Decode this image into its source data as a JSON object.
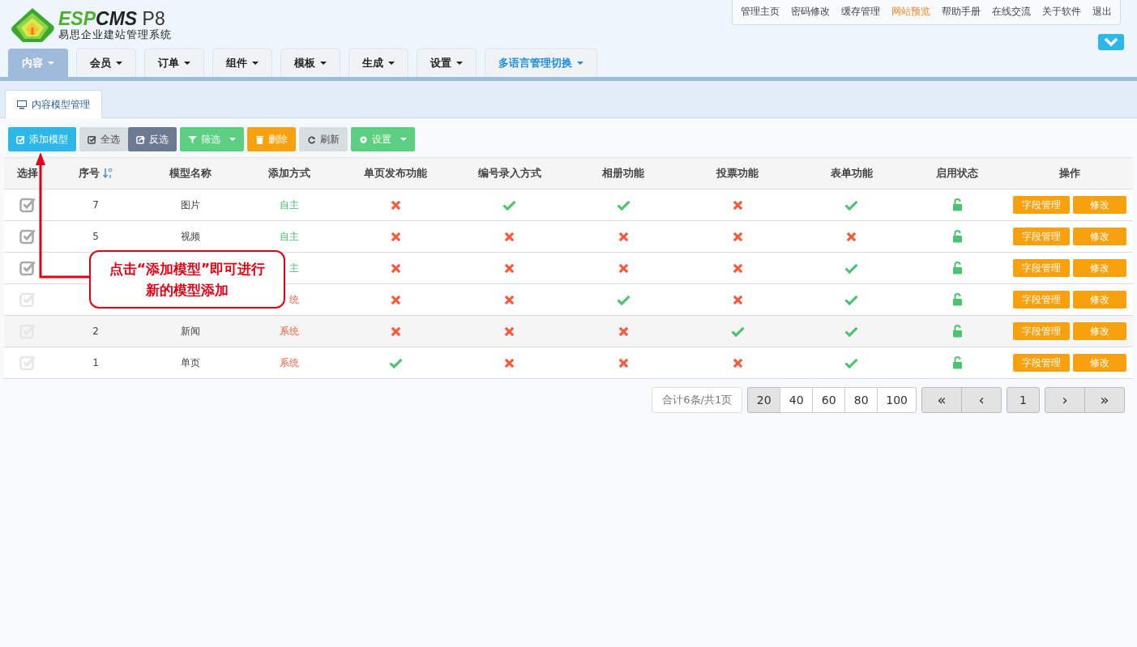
{
  "logo": {
    "brand_a": "ESP",
    "brand_b": "CMS",
    "version": "P8",
    "subtitle": "易思企业建站管理系统"
  },
  "top_links": [
    {
      "label": "管理主页",
      "highlighted": false
    },
    {
      "label": "密码修改",
      "highlighted": false
    },
    {
      "label": "缓存管理",
      "highlighted": false
    },
    {
      "label": "网站预览",
      "highlighted": true
    },
    {
      "label": "帮助手册",
      "highlighted": false
    },
    {
      "label": "在线交流",
      "highlighted": false
    },
    {
      "label": "关于软件",
      "highlighted": false
    },
    {
      "label": "退出",
      "highlighted": false
    }
  ],
  "nav_tabs": [
    {
      "label": "内容",
      "selected": true,
      "kind": "normal"
    },
    {
      "label": "会员",
      "selected": false,
      "kind": "normal"
    },
    {
      "label": "订单",
      "selected": false,
      "kind": "normal"
    },
    {
      "label": "组件",
      "selected": false,
      "kind": "normal"
    },
    {
      "label": "模板",
      "selected": false,
      "kind": "normal"
    },
    {
      "label": "生成",
      "selected": false,
      "kind": "normal"
    },
    {
      "label": "设置",
      "selected": false,
      "kind": "normal"
    },
    {
      "label": "多语言管理切换",
      "selected": false,
      "kind": "language"
    }
  ],
  "page_tab": {
    "label": "内容模型管理"
  },
  "toolbar": [
    {
      "label": "添加模型",
      "kind": "add",
      "dropdown": false
    },
    {
      "label": "全选",
      "kind": "select-all",
      "dropdown": false
    },
    {
      "label": "反选",
      "kind": "invert",
      "dropdown": false
    },
    {
      "label": "筛选",
      "kind": "filter",
      "dropdown": true
    },
    {
      "label": "删除",
      "kind": "delete",
      "dropdown": false
    },
    {
      "label": "刷新",
      "kind": "refresh",
      "dropdown": false
    },
    {
      "label": "设置",
      "kind": "settings",
      "dropdown": true
    }
  ],
  "table": {
    "columns": [
      "选择",
      "序号",
      "模型名称",
      "添加方式",
      "单页发布功能",
      "编号录入方式",
      "相册功能",
      "投票功能",
      "表单功能",
      "启用状态",
      "操作"
    ],
    "rows": [
      {
        "selectable": true,
        "number": "7",
        "name": "图片",
        "method": "自主",
        "kind": "custom",
        "single_page": false,
        "code_entry": true,
        "album": true,
        "vote": false,
        "form": true,
        "enabled": true,
        "actions": [
          "字段管理",
          "修改"
        ]
      },
      {
        "selectable": true,
        "number": "5",
        "name": "视频",
        "method": "自主",
        "kind": "custom",
        "single_page": false,
        "code_entry": false,
        "album": false,
        "vote": false,
        "form": false,
        "enabled": true,
        "actions": [
          "字段管理",
          "修改"
        ]
      },
      {
        "selectable": true,
        "method": "主",
        "kind": "custom",
        "single_page": false,
        "code_entry": false,
        "album": false,
        "vote": false,
        "form": true,
        "enabled": true,
        "actions": [
          "字段管理",
          "修改"
        ]
      },
      {
        "selectable": false,
        "method": "统",
        "kind": "system",
        "single_page": false,
        "code_entry": false,
        "album": true,
        "vote": false,
        "form": true,
        "enabled": true,
        "actions": [
          "字段管理",
          "修改"
        ]
      },
      {
        "selectable": false,
        "number": "2",
        "name": "新闻",
        "method": "系统",
        "kind": "system",
        "single_page": false,
        "code_entry": false,
        "album": false,
        "vote": true,
        "form": true,
        "enabled": true,
        "actions": [
          "字段管理",
          "修改"
        ]
      },
      {
        "selectable": false,
        "number": "1",
        "name": "单页",
        "method": "系统",
        "kind": "system",
        "single_page": true,
        "code_entry": false,
        "album": false,
        "vote": false,
        "form": true,
        "enabled": true,
        "actions": [
          "字段管理",
          "修改"
        ]
      }
    ]
  },
  "pagination": {
    "summary": "合计6条/共1页",
    "page_sizes": [
      {
        "label": "20",
        "selected": true
      },
      {
        "label": "40",
        "selected": false
      },
      {
        "label": "60",
        "selected": false
      },
      {
        "label": "80",
        "selected": false
      },
      {
        "label": "100",
        "selected": false
      }
    ],
    "first": "«",
    "prev": "‹",
    "pages": [
      {
        "label": "1",
        "selected": true
      }
    ],
    "next": "›",
    "last": "»"
  },
  "callout": {
    "text": "点击“添加模型”即可进行新的模型添加"
  }
}
